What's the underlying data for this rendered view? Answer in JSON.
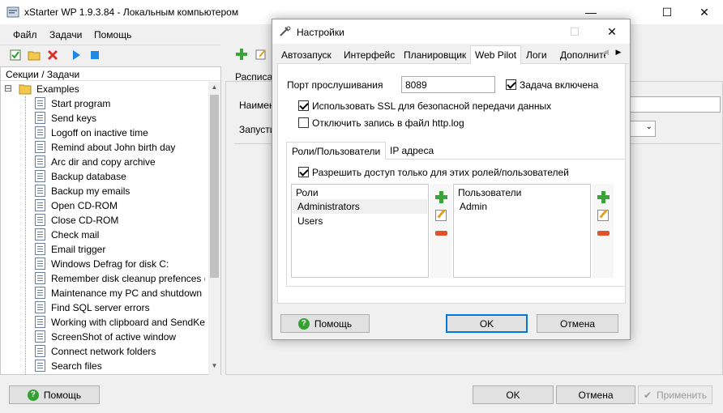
{
  "app": {
    "title": "xStarter WP 1.9.3.84 - Локальным компьютером",
    "minimize_glyph": "—",
    "maximize_glyph": "☐",
    "close_glyph": "✕"
  },
  "menu": {
    "file": "Файл",
    "tasks": "Задачи",
    "help": "Помощь"
  },
  "tree": {
    "header": "Секции / Задачи",
    "root_label": "Examples",
    "expand_glyph": "⊟",
    "items": [
      "Start program",
      "Send keys",
      "Logoff on inactive time",
      "Remind about John birth day",
      "Arc dir and copy archive",
      "Backup database",
      "Backup my emails",
      "Open CD-ROM",
      "Close CD-ROM",
      "Check mail",
      "Email trigger",
      "Windows Defrag for disk C:",
      "Remember disk cleanup prefences (r…",
      "Maintenance my PC and shutdown",
      "Find SQL server errors",
      "Working with clipboard and SendKey",
      "ScreenShot of active window",
      "Connect network folders",
      "Search files"
    ]
  },
  "right_panel": {
    "tab_label": "Расписан",
    "name_label": "Наимено",
    "launch_label": "Запусти"
  },
  "bottom": {
    "help": "Помощь",
    "ok": "OK",
    "cancel": "Отмена",
    "apply": "Применить"
  },
  "dialog": {
    "title": "Настройки",
    "tabs": [
      "Автозапуск",
      "Интерфейс",
      "Планировщик",
      "Web Pilot",
      "Логи",
      "Дополните"
    ],
    "active_tab": "Web Pilot",
    "port_label": "Порт прослушивания",
    "port_value": "8089",
    "task_enabled": {
      "label": "Задача включена",
      "checked": true
    },
    "use_ssl": {
      "label": "Использовать SSL для безопасной передачи данных",
      "checked": true
    },
    "disable_log": {
      "label": "Отключить запись в файл http.log",
      "checked": false
    },
    "inner_tabs": [
      "Роли/Пользователи",
      "IP адреса"
    ],
    "allow_only": {
      "label": "Разрешить доступ только для этих ролей/пользователей",
      "checked": true
    },
    "roles": {
      "header": "Роли",
      "items": [
        "Administrators",
        "Users"
      ]
    },
    "users": {
      "header": "Пользователи",
      "items": [
        "Admin"
      ]
    },
    "buttons": {
      "help": "Помощь",
      "ok": "OK",
      "cancel": "Отмена"
    }
  }
}
